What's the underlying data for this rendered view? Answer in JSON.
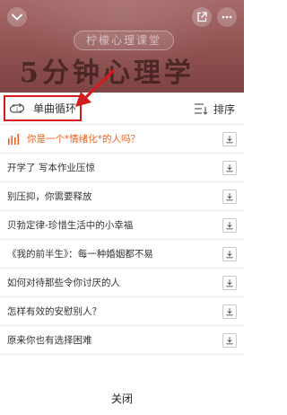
{
  "banner": {
    "pill_text": "柠檬心理课堂",
    "title_text": "5分钟心理学"
  },
  "toolbar": {
    "loop_mode_label": "单曲循环",
    "sort_label": "排序"
  },
  "playlist": {
    "items": [
      {
        "title": "你是一个*情绪化*的人吗？",
        "playing": true
      },
      {
        "title": "开学了 写本作业压惊",
        "playing": false
      },
      {
        "title": "别压抑，你需要释放",
        "playing": false
      },
      {
        "title": "贝勃定律-珍惜生活中的小幸福",
        "playing": false
      },
      {
        "title": "《我的前半生》：每一种婚姻都不易",
        "playing": false
      },
      {
        "title": "如何对待那些令你讨厌的人",
        "playing": false
      },
      {
        "title": "怎样有效的安慰别人？",
        "playing": false
      },
      {
        "title": "原来你也有选择困难",
        "playing": false
      }
    ]
  },
  "close_label": "关闭",
  "colors": {
    "playing_accent": "#e9611f",
    "highlight_box": "#d21b1b",
    "banner_bg": "#8f5150"
  },
  "icons": {
    "collapse": "chevron-down-icon",
    "share": "share-icon",
    "more": "more-icon",
    "loop": "repeat-one-icon",
    "sort": "sort-icon",
    "playing": "equalizer-icon",
    "download": "download-icon"
  }
}
